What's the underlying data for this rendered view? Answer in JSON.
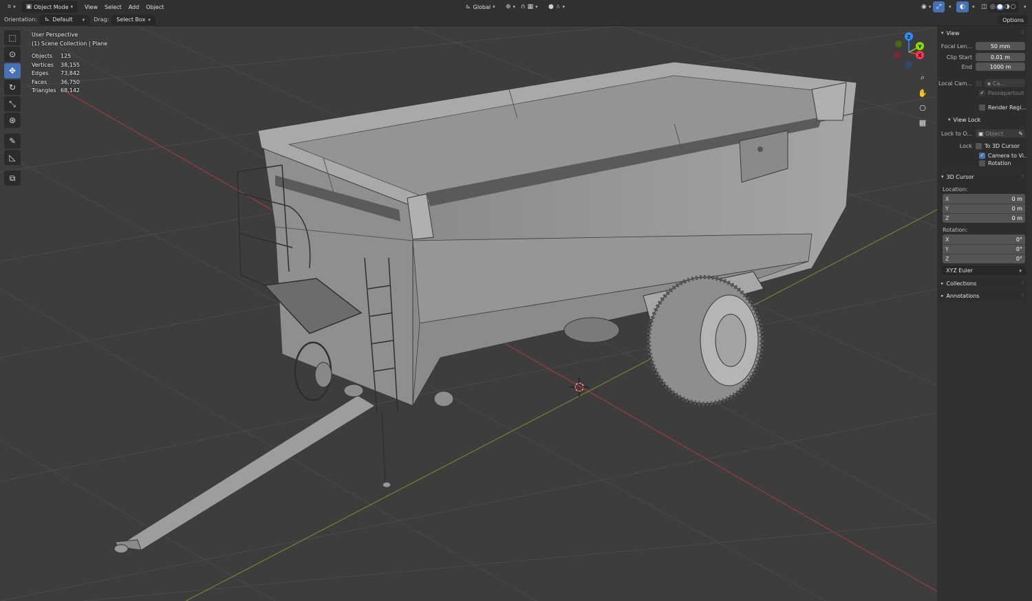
{
  "header": {
    "editor_type_icon": "editor-type-icon",
    "mode_label": "Object Mode",
    "menus": [
      "View",
      "Select",
      "Add",
      "Object"
    ],
    "transform_orientation": "Global",
    "shading_modes": [
      "wireframe",
      "solid",
      "material",
      "rendered"
    ]
  },
  "toolbar": {
    "orientation_label": "Orientation:",
    "orientation_value": "Default",
    "drag_label": "Drag:",
    "drag_value": "Select Box",
    "options_label": "Options"
  },
  "overlay": {
    "view_name": "User Perspective",
    "collection": "(1) Scene Collection | Plane",
    "stats": [
      {
        "key": "Objects",
        "value": "125"
      },
      {
        "key": "Vertices",
        "value": "38,155"
      },
      {
        "key": "Edges",
        "value": "73,842"
      },
      {
        "key": "Faces",
        "value": "36,750"
      },
      {
        "key": "Triangles",
        "value": "68,142"
      }
    ]
  },
  "gizmo": {
    "axes": [
      "X",
      "Y",
      "Z"
    ]
  },
  "sidebar": {
    "view_panel": {
      "title": "View",
      "focal_length_label": "Focal Len...",
      "focal_length": "50 mm",
      "clip_start_label": "Clip Start",
      "clip_start": "0.01 m",
      "clip_end_label": "End",
      "clip_end": "1000 m",
      "local_camera_label": "Local Cam...",
      "local_camera_value": "Ca...",
      "passepartout_label": "Passepartout",
      "render_region_label": "Render Regi..."
    },
    "view_lock_panel": {
      "title": "View Lock",
      "lock_to_object_label": "Lock to O...",
      "lock_to_object_placeholder": "Object",
      "lock_label": "Lock",
      "to_3d_cursor_label": "To 3D Cursor",
      "camera_to_view_label": "Camera to Vi...",
      "rotation_label": "Rotation"
    },
    "cursor_panel": {
      "title": "3D Cursor",
      "location_label": "Location:",
      "location": [
        {
          "axis": "X",
          "value": "0 m"
        },
        {
          "axis": "Y",
          "value": "0 m"
        },
        {
          "axis": "Z",
          "value": "0 m"
        }
      ],
      "rotation_label": "Rotation:",
      "rotation": [
        {
          "axis": "X",
          "value": "0°"
        },
        {
          "axis": "Y",
          "value": "0°"
        },
        {
          "axis": "Z",
          "value": "0°"
        }
      ],
      "rotation_mode": "XYZ Euler"
    },
    "collections_title": "Collections",
    "annotations_title": "Annotations"
  },
  "colors": {
    "accent": "#4772b3",
    "x_axis": "#ff3352",
    "y_axis": "#8bdc00",
    "z_axis": "#2890ff"
  }
}
